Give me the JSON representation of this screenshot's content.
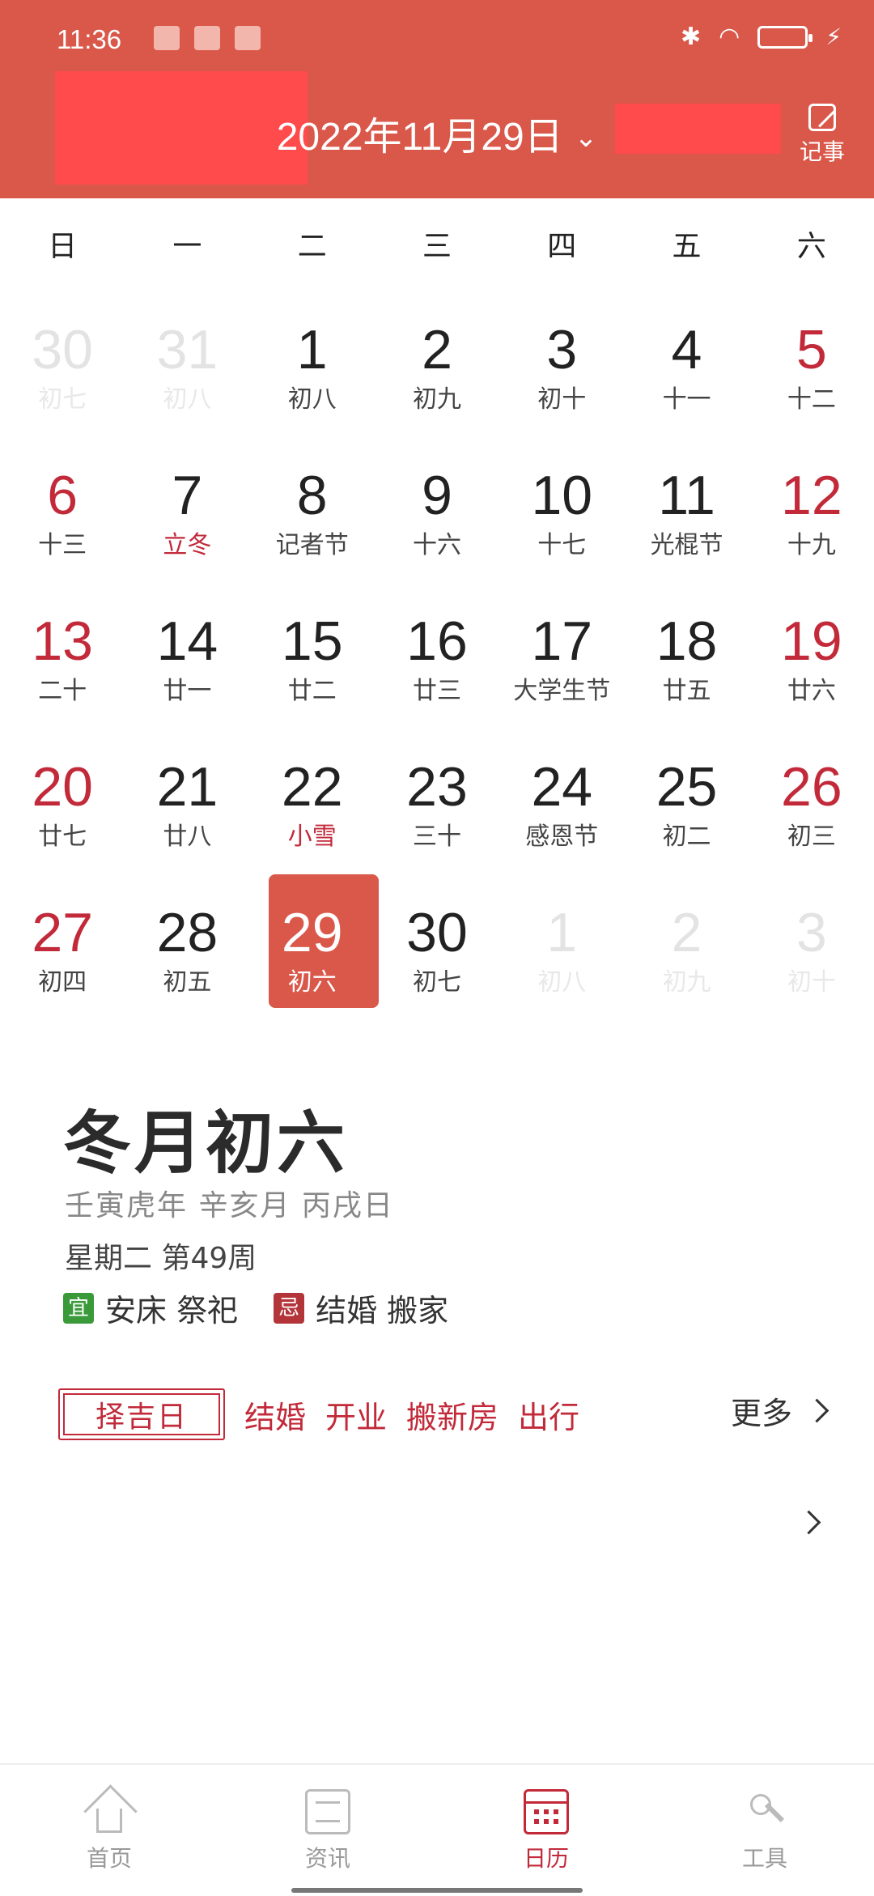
{
  "status": {
    "time": "11:36"
  },
  "header": {
    "title": "2022年11月29日",
    "note_label": "记事"
  },
  "weekdays": [
    "日",
    "一",
    "二",
    "三",
    "四",
    "五",
    "六"
  ],
  "days": [
    {
      "num": "30",
      "sub": "初七",
      "state": "other"
    },
    {
      "num": "31",
      "sub": "初八",
      "state": "other"
    },
    {
      "num": "1",
      "sub": "初八"
    },
    {
      "num": "2",
      "sub": "初九"
    },
    {
      "num": "3",
      "sub": "初十"
    },
    {
      "num": "4",
      "sub": "十一"
    },
    {
      "num": "5",
      "sub": "十二",
      "state": "weekend"
    },
    {
      "num": "6",
      "sub": "十三",
      "state": "weekend"
    },
    {
      "num": "7",
      "sub": "立冬",
      "state": "solar"
    },
    {
      "num": "8",
      "sub": "记者节"
    },
    {
      "num": "9",
      "sub": "十六"
    },
    {
      "num": "10",
      "sub": "十七"
    },
    {
      "num": "11",
      "sub": "光棍节"
    },
    {
      "num": "12",
      "sub": "十九",
      "state": "weekend"
    },
    {
      "num": "13",
      "sub": "二十",
      "state": "weekend"
    },
    {
      "num": "14",
      "sub": "廿一"
    },
    {
      "num": "15",
      "sub": "廿二"
    },
    {
      "num": "16",
      "sub": "廿三"
    },
    {
      "num": "17",
      "sub": "大学生节"
    },
    {
      "num": "18",
      "sub": "廿五"
    },
    {
      "num": "19",
      "sub": "廿六",
      "state": "weekend"
    },
    {
      "num": "20",
      "sub": "廿七",
      "state": "weekend"
    },
    {
      "num": "21",
      "sub": "廿八"
    },
    {
      "num": "22",
      "sub": "小雪",
      "state": "solar"
    },
    {
      "num": "23",
      "sub": "三十"
    },
    {
      "num": "24",
      "sub": "感恩节"
    },
    {
      "num": "25",
      "sub": "初二"
    },
    {
      "num": "26",
      "sub": "初三",
      "state": "weekend"
    },
    {
      "num": "27",
      "sub": "初四",
      "state": "weekend"
    },
    {
      "num": "28",
      "sub": "初五"
    },
    {
      "num": "29",
      "sub": "初六",
      "state": "selected"
    },
    {
      "num": "30",
      "sub": "初七"
    },
    {
      "num": "1",
      "sub": "初八",
      "state": "other"
    },
    {
      "num": "2",
      "sub": "初九",
      "state": "other"
    },
    {
      "num": "3",
      "sub": "初十",
      "state": "other"
    }
  ],
  "detail": {
    "lunar_title": "冬月初六",
    "ganzhi": "壬寅虎年  辛亥月  丙戌日",
    "week_info": "星期二 第49周",
    "yi_tag": "宜",
    "yi_text": "安床 祭祀",
    "ji_tag": "忌",
    "ji_text": "结婚 搬家",
    "pick_badge": "择吉日",
    "picks": [
      "结婚",
      "开业",
      "搬新房",
      "出行"
    ],
    "more": "更多"
  },
  "nav": [
    {
      "label": "首页",
      "icon": "home-icon"
    },
    {
      "label": "资讯",
      "icon": "news-icon"
    },
    {
      "label": "日历",
      "icon": "calendar-icon",
      "active": true
    },
    {
      "label": "工具",
      "icon": "tools-icon"
    }
  ],
  "colors": {
    "header_bg": "#D9584A",
    "accent": "#C22A3A",
    "yi": "#3A9A3A",
    "ji": "#B3353A"
  }
}
